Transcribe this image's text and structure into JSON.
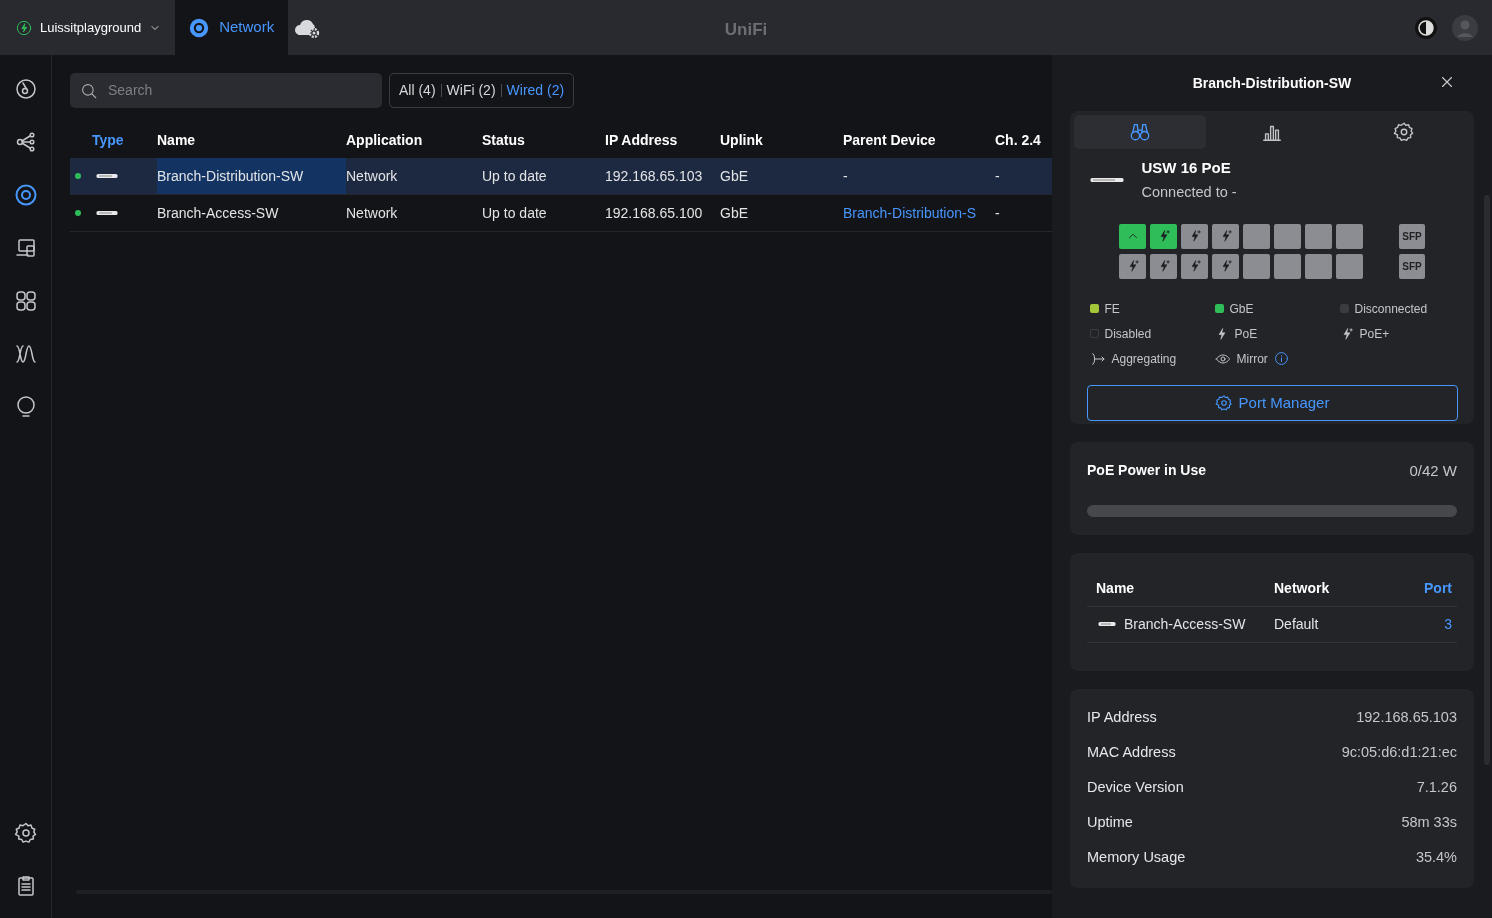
{
  "topbar": {
    "site": "Luissitplayground",
    "apps": [
      {
        "label": "Network",
        "selected": true
      }
    ],
    "logo": "UniFi"
  },
  "sidebar": {
    "items": [
      {
        "selected": false
      },
      {
        "selected": false
      },
      {
        "selected": true
      },
      {
        "selected": false
      },
      {
        "selected": false
      },
      {
        "selected": false
      },
      {
        "selected": false
      }
    ]
  },
  "search": {
    "placeholder": "Search"
  },
  "filters": [
    {
      "label": "All (4)",
      "selected": false
    },
    {
      "label": "WiFi (2)",
      "selected": false
    },
    {
      "label": "Wired (2)",
      "selected": true
    }
  ],
  "table": {
    "columns": [
      {
        "label": "Type",
        "sorted": true
      },
      {
        "label": "Name",
        "sorted": false
      },
      {
        "label": "Application",
        "sorted": false
      },
      {
        "label": "Status",
        "sorted": false
      },
      {
        "label": "IP Address",
        "sorted": false
      },
      {
        "label": "Uplink",
        "sorted": false
      },
      {
        "label": "Parent Device",
        "sorted": false
      },
      {
        "label": "Ch. 2.4",
        "sorted": false
      }
    ],
    "rows": [
      {
        "selected": true,
        "online": true,
        "name": "Branch-Distribution-SW",
        "application": "Network",
        "status": "Up to date",
        "ip_address": "192.168.65.103",
        "uplink": "GbE",
        "parent_device": "-",
        "parent_link": false,
        "ch_2_4": "-"
      },
      {
        "selected": false,
        "online": true,
        "name": "Branch-Access-SW",
        "application": "Network",
        "status": "Up to date",
        "ip_address": "192.168.65.100",
        "uplink": "GbE",
        "parent_device": "Branch-Distribution-S",
        "parent_link": true,
        "ch_2_4": "-"
      }
    ]
  },
  "panel": {
    "title": "Branch-Distribution-SW",
    "tabs": [
      {
        "selected": true
      },
      {
        "selected": false
      },
      {
        "selected": false
      }
    ],
    "model": "USW 16 PoE",
    "connected": "Connected to -",
    "ports": [
      {
        "kind": "uplink",
        "connected": true
      },
      {
        "kind": "poeplus",
        "connected": true
      },
      {
        "kind": "poeplus",
        "connected": false
      },
      {
        "kind": "poeplus",
        "connected": false
      },
      {
        "kind": "plain",
        "connected": false
      },
      {
        "kind": "plain",
        "connected": false
      },
      {
        "kind": "plain",
        "connected": false
      },
      {
        "kind": "plain",
        "connected": false
      },
      {
        "kind": "poeplus",
        "connected": false
      },
      {
        "kind": "poeplus",
        "connected": false
      },
      {
        "kind": "poeplus",
        "connected": false
      },
      {
        "kind": "poeplus",
        "connected": false
      },
      {
        "kind": "plain",
        "connected": false
      },
      {
        "kind": "plain",
        "connected": false
      },
      {
        "kind": "plain",
        "connected": false
      },
      {
        "kind": "plain",
        "connected": false
      }
    ],
    "sfp": [
      {
        "label": "SFP"
      },
      {
        "label": "SFP"
      }
    ],
    "legend": [
      {
        "kind": "swatch",
        "label": "FE",
        "color": "#a4c639"
      },
      {
        "kind": "swatch",
        "label": "GbE",
        "color": "#2ebd59"
      },
      {
        "kind": "swatch",
        "label": "Disconnected",
        "color": "#3a3c42"
      },
      {
        "kind": "outline",
        "label": "Disabled"
      },
      {
        "kind": "poe",
        "label": "PoE"
      },
      {
        "kind": "poeplus",
        "label": "PoE+"
      },
      {
        "kind": "aggregate",
        "label": "Aggregating"
      },
      {
        "kind": "mirror",
        "label": "Mirror"
      }
    ],
    "port_manager": "Port Manager",
    "poe": {
      "title": "PoE Power in Use",
      "reading": "0/42 W",
      "level": 0
    },
    "uplinks": {
      "columns": [
        "Name",
        "Network",
        "Port"
      ],
      "rows": [
        {
          "name": "Branch-Access-SW",
          "network": "Default",
          "port": "3"
        }
      ]
    },
    "details": [
      {
        "label": "IP Address",
        "value": "192.168.65.103"
      },
      {
        "label": "MAC Address",
        "value": "9c:05:d6:d1:21:ec"
      },
      {
        "label": "Device Version",
        "value": "7.1.26"
      },
      {
        "label": "Uptime",
        "value": "58m 33s"
      },
      {
        "label": "Memory Usage",
        "value": "35.4%"
      }
    ]
  }
}
